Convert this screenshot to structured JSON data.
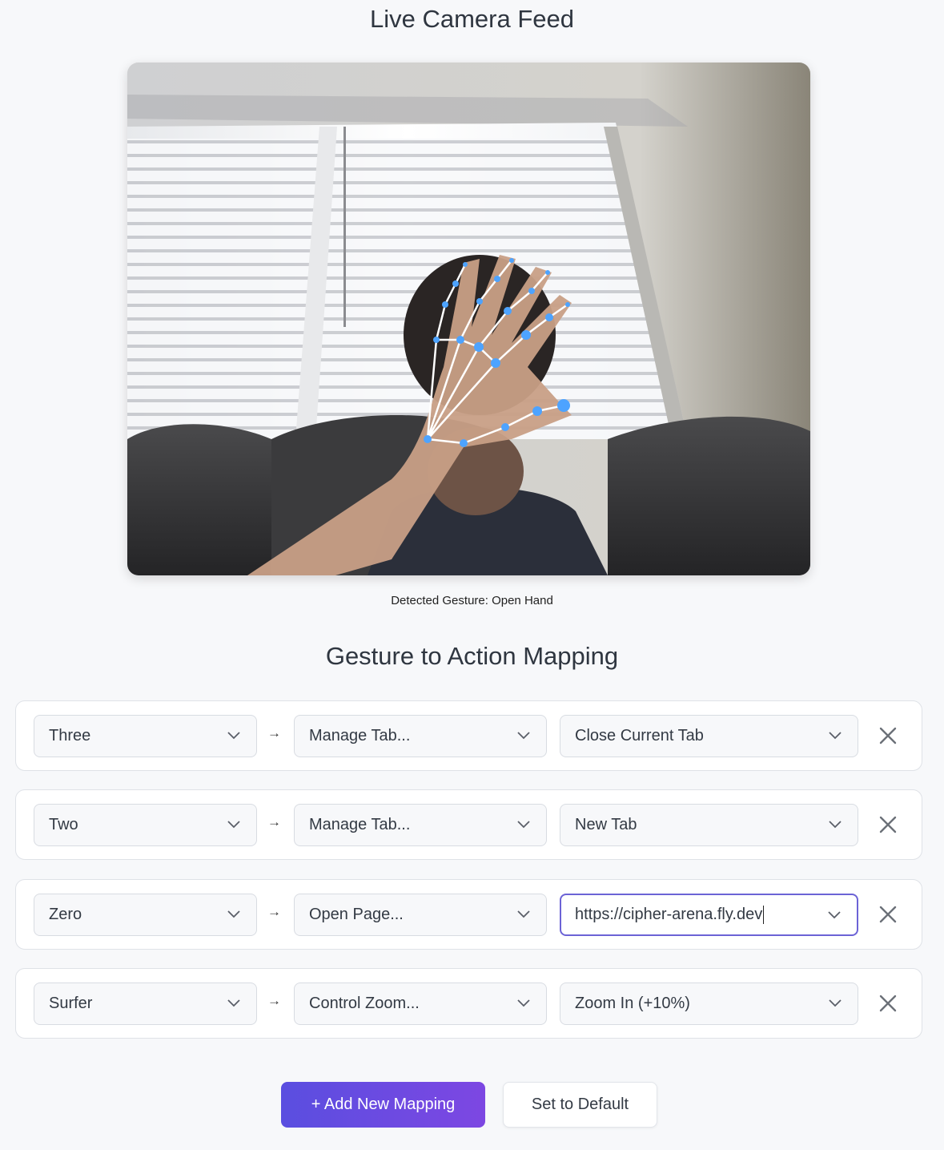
{
  "header": {
    "title": "Live Camera Feed"
  },
  "camera": {
    "detected_label": "Detected Gesture: Open Hand",
    "overlay_color": "#4da3ff"
  },
  "mapping": {
    "title": "Gesture to Action Mapping"
  },
  "rows": [
    {
      "gesture": "Three",
      "category": "Manage Tab...",
      "action": "Close Current Tab"
    },
    {
      "gesture": "Two",
      "category": "Manage Tab...",
      "action": "New Tab"
    },
    {
      "gesture": "Zero",
      "category": "Open Page...",
      "action": "https://cipher-arena.fly.dev"
    },
    {
      "gesture": "Surfer",
      "category": "Control Zoom...",
      "action": "Zoom In (+10%)"
    }
  ],
  "arrow_symbol": "→",
  "buttons": {
    "add": "+ Add New Mapping",
    "reset": "Set to Default"
  },
  "colors": {
    "accent_start": "#5a4ee0",
    "accent_end": "#7d47e2",
    "focus_border": "#6c63d6"
  }
}
